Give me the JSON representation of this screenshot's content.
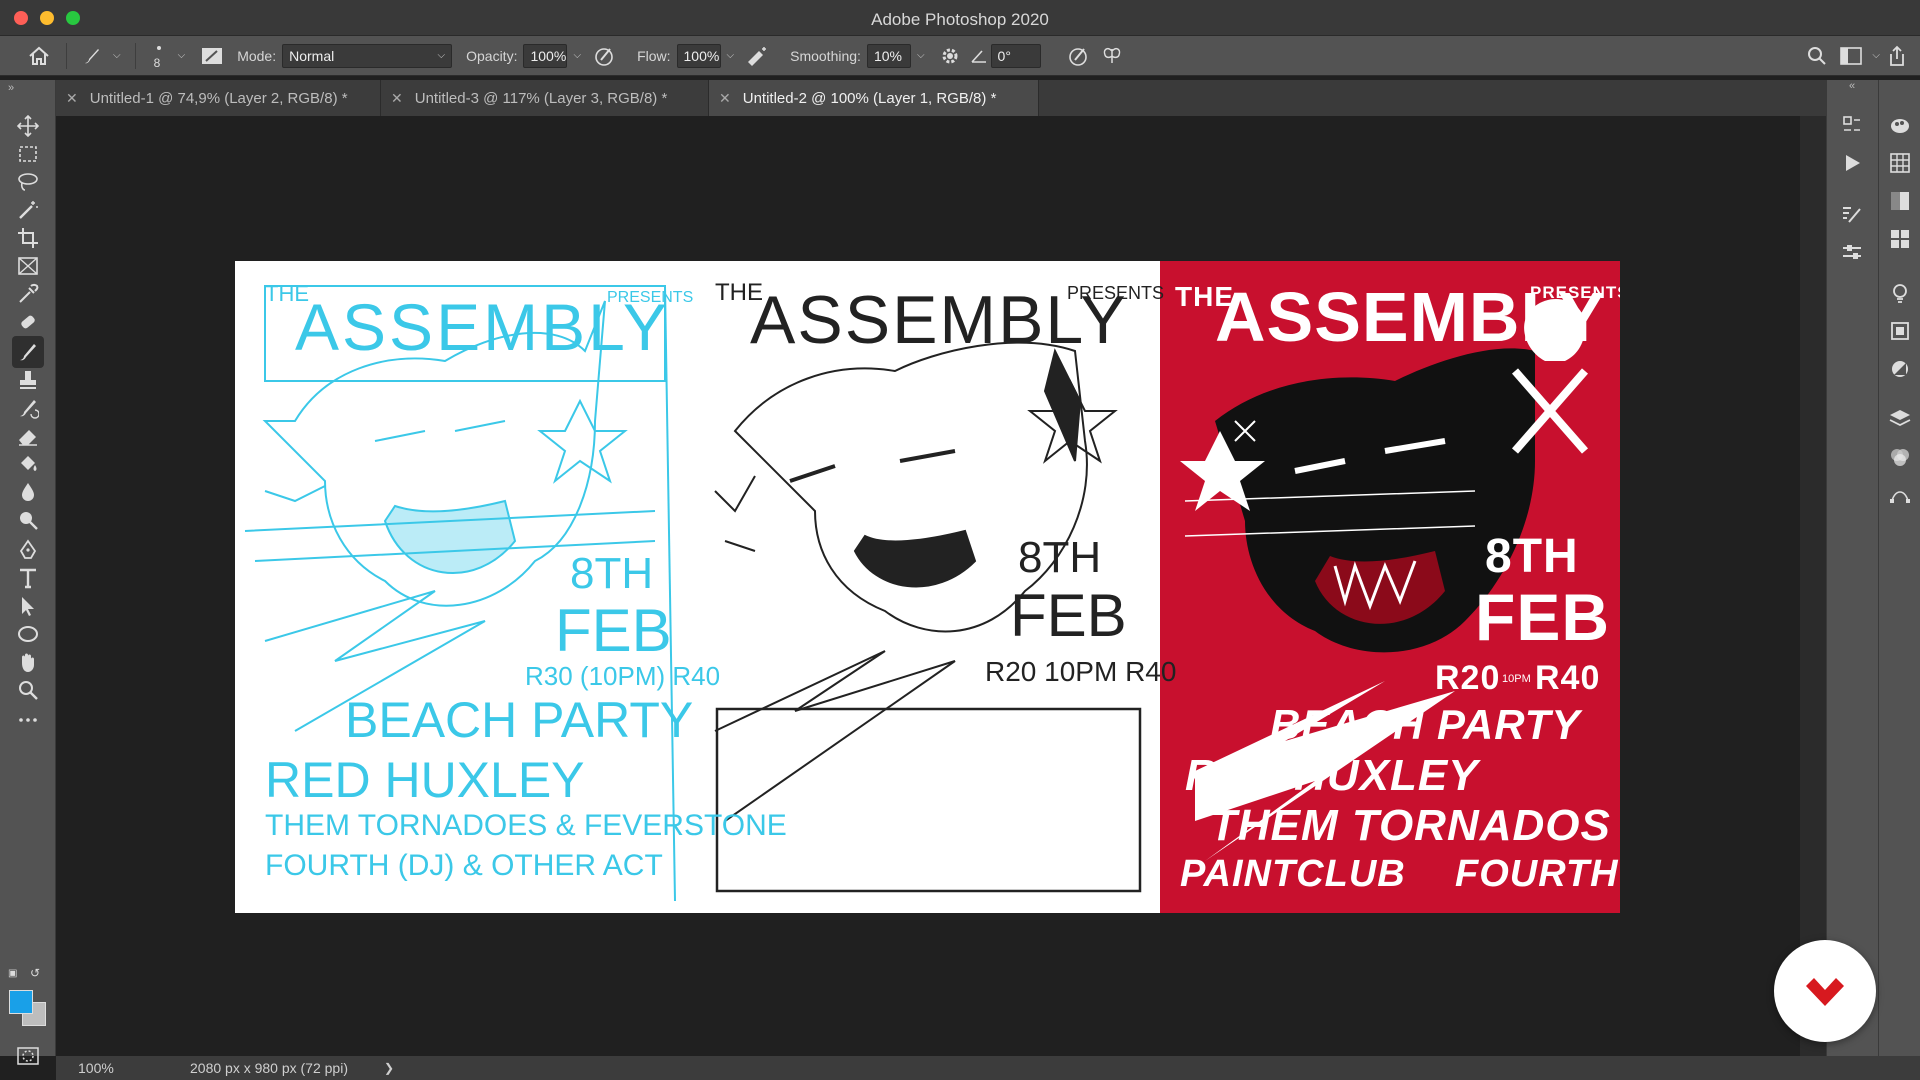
{
  "window": {
    "title": "Adobe Photoshop 2020"
  },
  "options_bar": {
    "brush_size": "8",
    "mode_label": "Mode:",
    "mode_value": "Normal",
    "opacity_label": "Opacity:",
    "opacity_value": "100%",
    "flow_label": "Flow:",
    "flow_value": "100%",
    "smoothing_label": "Smoothing:",
    "smoothing_value": "10%",
    "angle_value": "0°"
  },
  "tabs": [
    {
      "label": "Untitled-1 @ 74,9% (Layer 2, RGB/8) *",
      "active": false
    },
    {
      "label": "Untitled-3 @ 117% (Layer 3, RGB/8) *",
      "active": false
    },
    {
      "label": "Untitled-2 @ 100% (Layer 1, RGB/8) *",
      "active": true
    }
  ],
  "status_bar": {
    "zoom": "100%",
    "doc_info": "2080 px x 980 px (72 ppi)"
  },
  "artwork": {
    "sketch": {
      "title_the": "THE",
      "title": "ASSEMBLY",
      "presents": "PRESENTS",
      "date_day": "8TH",
      "date_month": "FEB",
      "price": "R30 (10PM) R40",
      "line1": "BEACH PARTY",
      "line2": "RED HUXLEY",
      "line3": "THEM TORNADOES & FEVERSTONE",
      "line4": "FOURTH (DJ) & OTHER ACT"
    },
    "inks": {
      "title_the": "THE",
      "title": "ASSEMBLY",
      "presents": "PRESENTS",
      "date_day": "8TH",
      "date_month": "FEB",
      "price": "R20 10PM R40"
    },
    "final": {
      "title_the": "THE",
      "title": "ASSEMBLY",
      "presents": "PRESENTS",
      "date_day": "8TH",
      "date_month": "FEB",
      "price_a": "R20",
      "price_time": "10PM",
      "price_b": "R40",
      "line1": "BEACH PARTY",
      "line2": "RED HUXLEY",
      "line3": "THEM TORNADOS",
      "line4": "PAINTCLUB",
      "line5": "FOURTH"
    }
  },
  "colors": {
    "foreground": "#19a0e8",
    "background": "#bdbdbd",
    "poster_red": "#c8102e",
    "sketch_blue": "#3bc8e8"
  },
  "icons": {
    "tools": [
      "move-icon",
      "marquee-icon",
      "lasso-icon",
      "magic-wand-icon",
      "crop-icon",
      "frame-icon",
      "eyedropper-icon",
      "healing-brush-icon",
      "brush-icon",
      "stamp-icon",
      "history-brush-icon",
      "eraser-icon",
      "paint-bucket-icon",
      "blur-icon",
      "dodge-icon",
      "pen-icon",
      "type-icon",
      "path-selection-icon",
      "ellipse-icon",
      "hand-icon",
      "zoom-icon",
      "more-tools-icon"
    ]
  }
}
